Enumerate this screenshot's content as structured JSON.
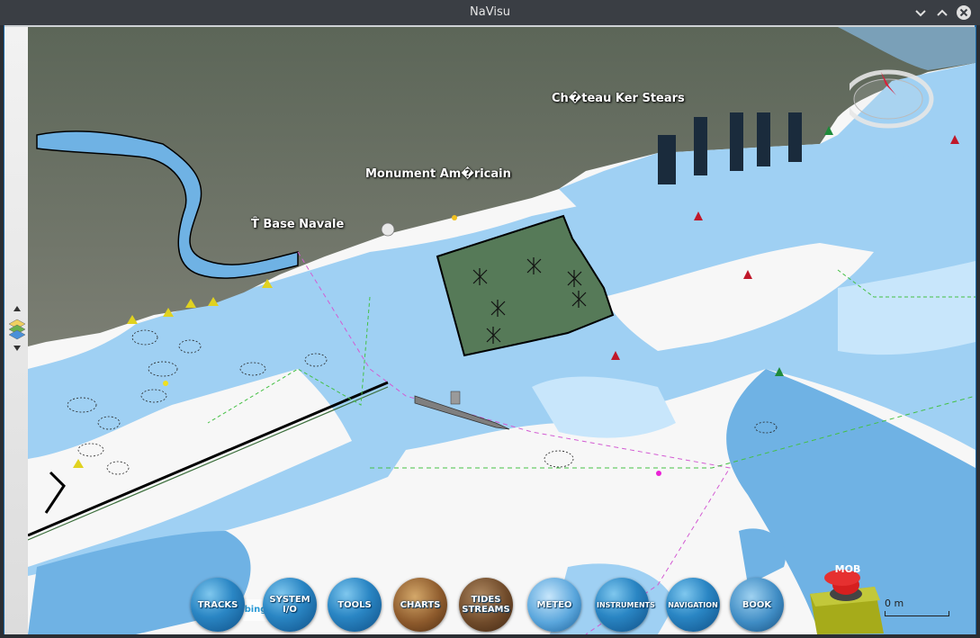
{
  "window": {
    "title": "NaVisu"
  },
  "map": {
    "labels": {
      "chateau": "Ch�teau Ker Stears",
      "monument": "Monument Am�ricain",
      "base": "T̑ Base Navale"
    },
    "scale_text": "0 m",
    "bing_text": "bing"
  },
  "toolbar": {
    "tracks": "TRACKS",
    "system_io": "SYSTEM I/O",
    "tools": "TOOLS",
    "charts": "CHARTS",
    "tides_streams": "TIDES STREAMS",
    "meteo": "METEO",
    "instruments": "INSTRUMENTS",
    "navigation": "NAVIGATION",
    "book": "BOOK",
    "mob": "MOB"
  },
  "colors": {
    "deep_water": "#6fb2e4",
    "mid_water": "#9fd0f3",
    "shallow": "#c8e6fb",
    "drying": "#f7f7f7",
    "land": "#6a7062",
    "dock": "#567a58",
    "accent": "#1d6aa8"
  },
  "icons": {
    "tracks": "compass-rose-icon",
    "meteo": "cloud-icon",
    "book": "book-icon",
    "navigation": "sailboat-icon",
    "mob": "red-button-icon"
  }
}
